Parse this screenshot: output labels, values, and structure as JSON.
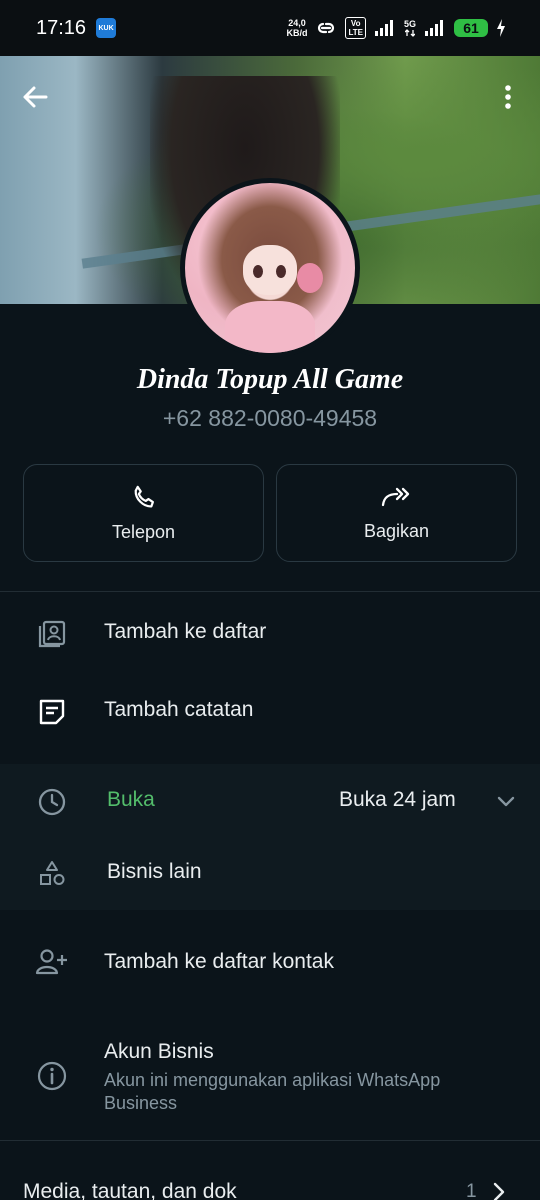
{
  "status_bar": {
    "time": "17:16",
    "network_speed_value": "24,0",
    "network_speed_unit": "KB/d",
    "volte_label": "Vo\nLTE",
    "network_type": "5G",
    "battery": "61",
    "badge_label": "KUK"
  },
  "profile": {
    "name": "Dinda Topup All Game",
    "phone": "+62 882-0080-49458"
  },
  "actions": [
    {
      "label": "Telepon",
      "icon": "phone-icon"
    },
    {
      "label": "Bagikan",
      "icon": "share-icon"
    }
  ],
  "menu": {
    "add_to_list": "Tambah ke daftar",
    "add_note": "Tambah catatan",
    "hours_status": "Buka",
    "hours_value": "Buka 24 jam",
    "other_business": "Bisnis lain",
    "add_contact": "Tambah ke daftar kontak",
    "business_account_title": "Akun Bisnis",
    "business_account_desc": "Akun ini menggunakan aplikasi WhatsApp Business",
    "media_label": "Media, tautan, dan dok",
    "media_count": "1"
  },
  "colors": {
    "background": "#0b141a",
    "accent_green": "#53bd6b",
    "secondary_text": "#8696a0"
  }
}
